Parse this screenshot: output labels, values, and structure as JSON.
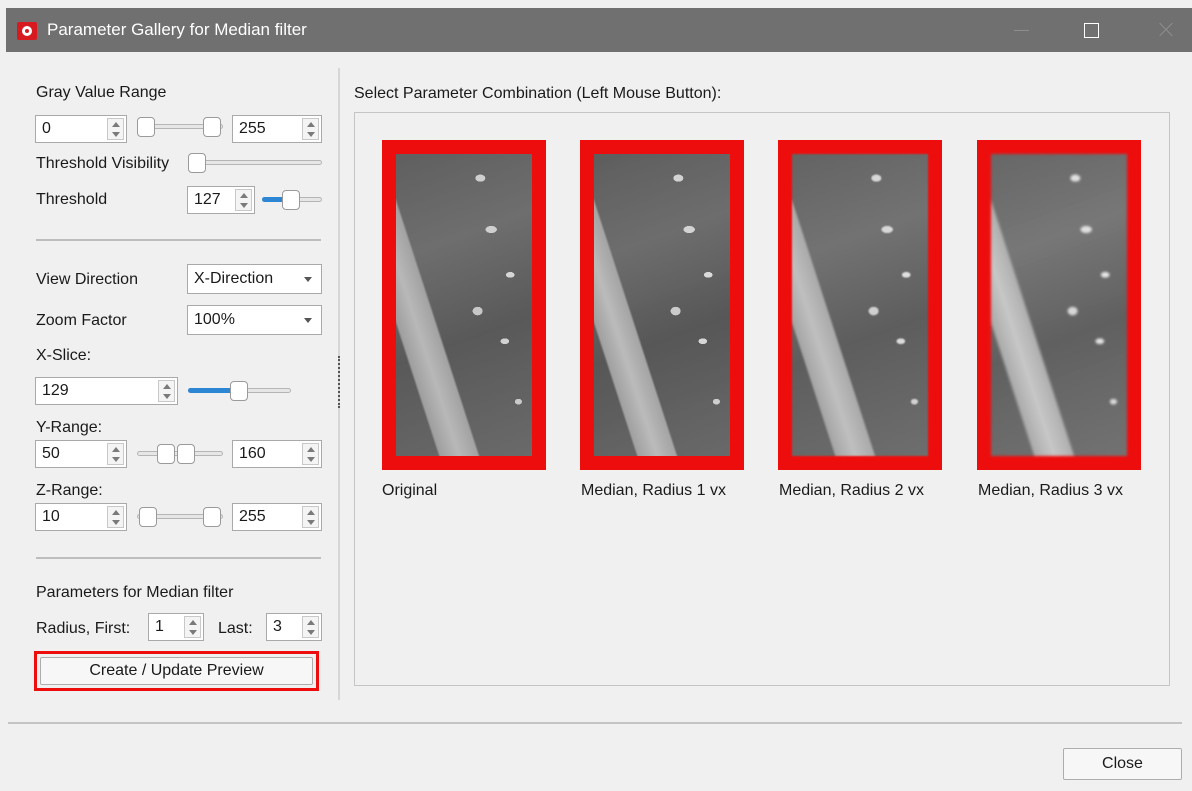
{
  "window": {
    "title": "Parameter Gallery for Median filter",
    "icon": "app-logo-icon"
  },
  "left_panel": {
    "gray_value_range": {
      "label": "Gray Value Range",
      "min": "0",
      "max": "255"
    },
    "threshold_visibility": {
      "label": "Threshold Visibility",
      "level": 0
    },
    "threshold": {
      "label": "Threshold",
      "value": "127",
      "slider_level": 0.5
    },
    "view_direction": {
      "label": "View Direction",
      "value": "X-Direction"
    },
    "zoom_factor": {
      "label": "Zoom Factor",
      "value": "100%"
    },
    "x_slice": {
      "label": "X-Slice:",
      "value": "129",
      "slider_level": 0.5
    },
    "y_range": {
      "label": "Y-Range:",
      "min": "50",
      "max": "160"
    },
    "z_range": {
      "label": "Z-Range:",
      "min": "10",
      "max": "255"
    },
    "params": {
      "title": "Parameters for Median filter",
      "radius_first_label": "Radius, First:",
      "radius_first": "1",
      "radius_last_label": "Last:",
      "radius_last": "3"
    },
    "preview_button": "Create / Update Preview"
  },
  "gallery": {
    "heading": "Select Parameter Combination (Left Mouse Button):",
    "items": [
      {
        "caption": "Original"
      },
      {
        "caption": "Median, Radius 1 vx"
      },
      {
        "caption": "Median, Radius 2 vx"
      },
      {
        "caption": "Median, Radius 3 vx"
      }
    ],
    "frame_color": "#ee0d0d"
  },
  "footer": {
    "close_button": "Close"
  }
}
